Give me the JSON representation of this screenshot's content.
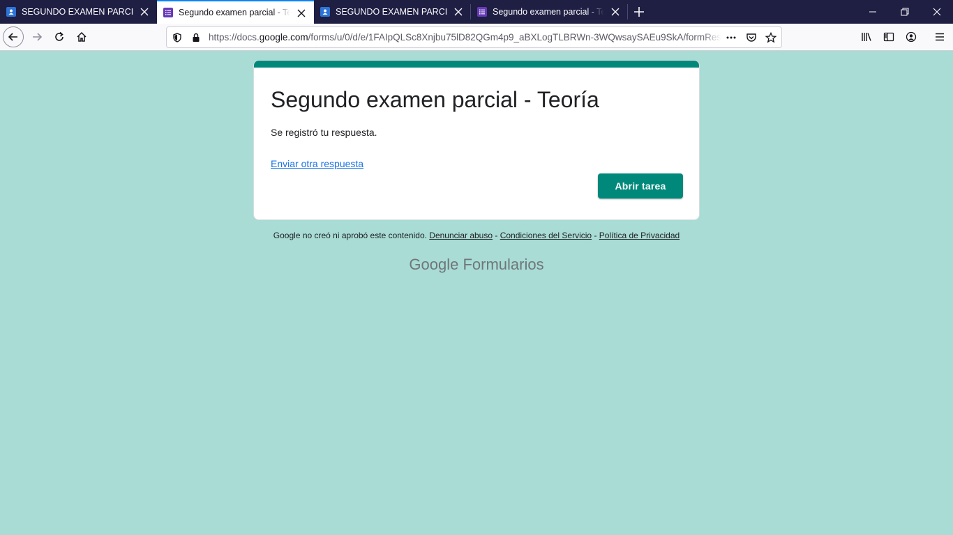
{
  "tabs": [
    {
      "title": "SEGUNDO EXAMEN PARCIAL",
      "icon": "classroom-icon",
      "active": false
    },
    {
      "title": "Segundo examen parcial - Teoría",
      "icon": "forms-icon",
      "active": true
    },
    {
      "title": "SEGUNDO EXAMEN PARCIAL",
      "icon": "classroom-icon",
      "active": false
    },
    {
      "title": "Segundo examen parcial - Teoría",
      "icon": "forms-icon",
      "active": false
    }
  ],
  "url": {
    "prefix": "https://docs.",
    "host": "google.com",
    "path": "/forms/u/0/d/e/1FAIpQLSc8Xnjbu75lD82QGm4p9_aBXLogTLBRWn-3WQwsaySAEu9SkA/formResponse"
  },
  "form": {
    "title": "Segundo examen parcial - Teoría",
    "message": "Se registró tu respuesta.",
    "link": "Enviar otra respuesta",
    "button": "Abrir tarea"
  },
  "footer": {
    "text": "Google no creó ni aprobó este contenido.",
    "sep": " - ",
    "abuse": "Denunciar abuso",
    "terms": "Condiciones del Servicio",
    "privacy": "Política de Privacidad"
  },
  "brand": {
    "part1": "Google",
    "part2": "Formularios"
  },
  "colors": {
    "accent": "#00897b",
    "page_bg": "#a8dcd5",
    "link": "#1a73e8"
  }
}
